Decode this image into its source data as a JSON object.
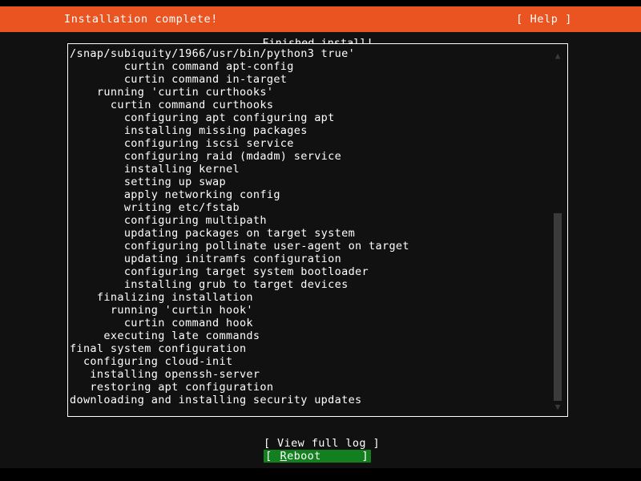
{
  "colors": {
    "background": "#111111",
    "letterbox": "#000000",
    "header_bg": "#e95420",
    "header_fg": "#ffffff",
    "text": "#ffffff",
    "highlight_bg": "#138020",
    "scrollbar_thumb": "#3b3b3b"
  },
  "header": {
    "title": "Installation complete!",
    "help_label": "[ Help ]"
  },
  "logbox": {
    "title": "Finished install!",
    "lines": [
      "/snap/subiquity/1966/usr/bin/python3 true'",
      "        curtin command apt-config",
      "        curtin command in-target",
      "    running 'curtin curthooks'",
      "      curtin command curthooks",
      "        configuring apt configuring apt",
      "        installing missing packages",
      "        configuring iscsi service",
      "        configuring raid (mdadm) service",
      "        installing kernel",
      "        setting up swap",
      "        apply networking config",
      "        writing etc/fstab",
      "        configuring multipath",
      "        updating packages on target system",
      "        configuring pollinate user-agent on target",
      "        updating initramfs configuration",
      "        configuring target system bootloader",
      "        installing grub to target devices",
      "    finalizing installation",
      "      running 'curtin hook'",
      "        curtin command hook",
      "     executing late commands",
      "final system configuration",
      "  configuring cloud-init",
      "   installing openssh-server",
      "   restoring apt configuration",
      "downloading and installing security updates"
    ]
  },
  "scrollbar": {
    "up_arrow": "scroll-up-arrow",
    "down_arrow": "scroll-down-arrow",
    "up_glyph": "▲",
    "down_glyph": "▼"
  },
  "footer": {
    "view_log_label": "[ View full log ]",
    "reboot": {
      "bracket_left": "[",
      "accel": "R",
      "rest": "eboot",
      "bracket_right": "]"
    }
  }
}
